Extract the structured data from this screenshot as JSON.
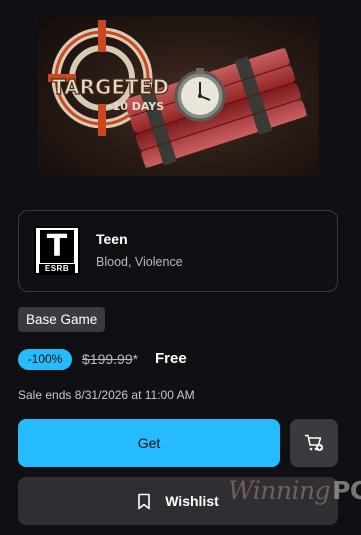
{
  "hero": {
    "title_line1": "TARGETED",
    "title_line2": "-10 DAYS"
  },
  "rating": {
    "esrb_letter": "T",
    "esrb_label": "ESRB",
    "title": "Teen",
    "descriptors": "Blood, Violence"
  },
  "product": {
    "type_badge": "Base Game",
    "discount": "-100%",
    "original_price": "$199.99",
    "original_price_mark": "*",
    "current_price": "Free",
    "sale_ends": "Sale ends 8/31/2026 at 11:00 AM"
  },
  "actions": {
    "get_label": "Get",
    "wishlist_label": "Wishlist"
  },
  "watermark": {
    "text": "Winning",
    "suffix": "PC"
  },
  "colors": {
    "accent": "#26bbff",
    "background": "#101014"
  }
}
